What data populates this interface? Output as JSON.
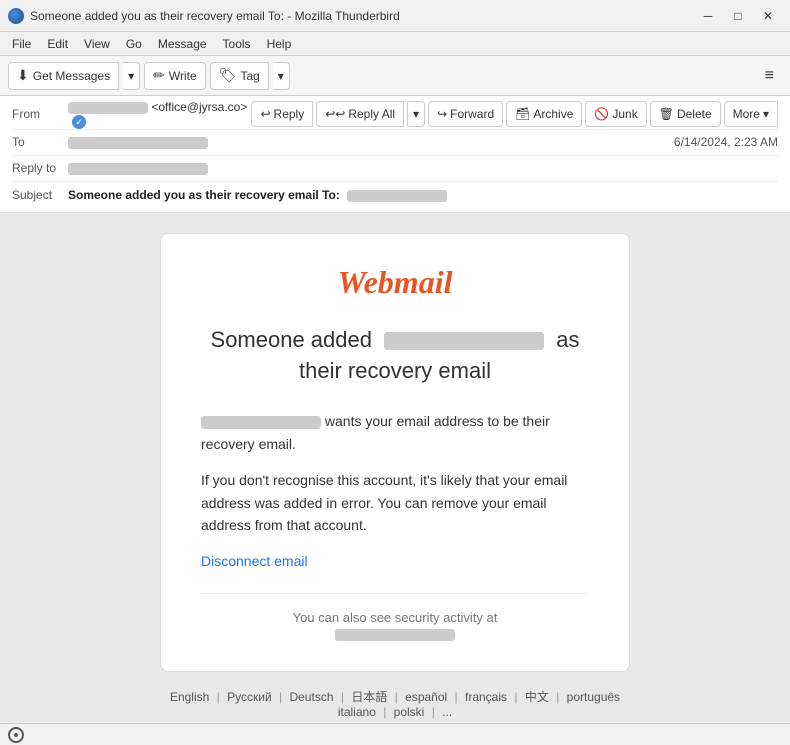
{
  "window": {
    "title": "Someone added you as their recovery email To: - Mozilla Thunderbird",
    "app_icon": "thunderbird-icon"
  },
  "title_bar": {
    "title": "Someone added you as their recovery email To:              - Mozilla Thunderbird",
    "minimize_label": "─",
    "maximize_label": "□",
    "close_label": "✕"
  },
  "menu": {
    "items": [
      "File",
      "Edit",
      "View",
      "Go",
      "Message",
      "Tools",
      "Help"
    ]
  },
  "toolbar": {
    "get_messages_label": "Get Messages",
    "write_label": "Write",
    "tag_label": "Tag",
    "hamburger_label": "≡"
  },
  "header": {
    "from_label": "From",
    "from_email": "<office@jyrsa.co>",
    "to_label": "To",
    "reply_to_label": "Reply to",
    "subject_label": "Subject",
    "subject_value": "Someone added you as their recovery email To:",
    "date_value": "6/14/2024, 2:23 AM"
  },
  "actions": {
    "reply_label": "Reply",
    "reply_all_label": "Reply All",
    "forward_label": "Forward",
    "archive_label": "Archive",
    "junk_label": "Junk",
    "delete_label": "Delete",
    "more_label": "More"
  },
  "email_content": {
    "logo": "Webmail",
    "title_part1": "Someone added",
    "title_part2": "as",
    "title_part3": "their recovery email",
    "body_part1": "wants your email address to be their recovery email.",
    "body_part2": "If you don't recognise this account, it's likely that your email address was added in error. You can remove your email address from that account.",
    "disconnect_link": "Disconnect email",
    "security_text": "You can also see security activity at"
  },
  "languages": {
    "items": [
      "English",
      "Русский",
      "Deutsch",
      "日本語",
      "español",
      "français",
      "中文",
      "português",
      "italiano",
      "polski",
      "..."
    ]
  },
  "status_bar": {
    "icon": "radio-icon"
  }
}
